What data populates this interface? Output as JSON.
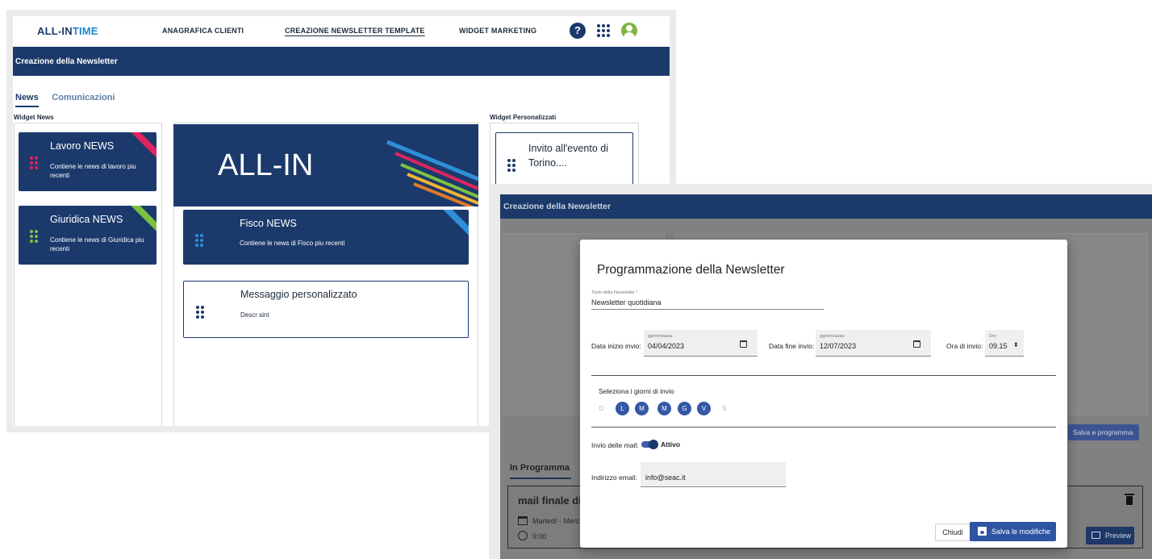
{
  "app": {
    "logo_text": "ALL-IN",
    "logo_accent": "TIME",
    "nav": [
      "ANAGRAFICA CLIENTI",
      "CREAZIONE NEWSLETTER TEMPLATE",
      "WIDGET MARKETING"
    ],
    "help_glyph": "?"
  },
  "screen1": {
    "title": "Creazione della Newsletter",
    "tabs": [
      "News",
      "Comunicazioni"
    ],
    "widget_news_label": "Widget News",
    "widget_pers_label": "Widget Personalizzati",
    "widgets_left": [
      {
        "title": "Lavoro NEWS",
        "desc": "Contiene le news di lavoro piu recenti",
        "accent": "#e0245e"
      },
      {
        "title": "Giuridica NEWS",
        "desc": "Contiene le news di Giuridica piu recenti",
        "accent": "#7cc242"
      }
    ],
    "banner_text": "ALL-IN",
    "center_widgets": [
      {
        "title": "Fisco NEWS",
        "desc": "Contiene le news di Fisco piu recenti",
        "accent": "#2f8fd8"
      },
      {
        "title": "Messaggio personalizzato",
        "desc": "Descr sint"
      }
    ],
    "custom_widget": {
      "title": "Invito all'evento di Torino...."
    }
  },
  "screen2": {
    "title": "Creazione della Newsletter",
    "salva_programma": "Salva e programma",
    "in_programma": "In Programma",
    "mail_card": {
      "title": "mail finale di",
      "days": "Martedì - Merc",
      "time": "9:00",
      "preview": "Preview"
    }
  },
  "modal": {
    "title": "Programmazione della Newsletter",
    "titolo_label": "Titolo della Newsletter *",
    "titolo_value": "Newsletter quotidiana",
    "data_inizio_label": "Data inizio invio:",
    "data_inizio_hint": "gg/mm/aaaa",
    "data_inizio_value": "04/04/2023",
    "data_fine_label": "Data fine invio:",
    "data_fine_hint": "gg/mm/aaaa",
    "data_fine_value": "12/07/2023",
    "ora_label": "Ora di invio:",
    "ora_hint": "Ore",
    "ora_value": "09.15",
    "giorni_label": "Seleziona i giorni di invio",
    "days": [
      {
        "label": "D",
        "selected": false
      },
      {
        "label": "L",
        "selected": true
      },
      {
        "label": "M",
        "selected": true
      },
      {
        "label": "M",
        "selected": true
      },
      {
        "label": "G",
        "selected": true
      },
      {
        "label": "V",
        "selected": true
      },
      {
        "label": "S",
        "selected": false
      }
    ],
    "invio_mail_label": "Invio delle mail:",
    "invio_mail_state": "Attivo",
    "email_label": "Indirizzo email:",
    "email_value": "info@seac.it",
    "chiudi": "Chiudi",
    "salva": "Salva le modifiche"
  },
  "colors": {
    "primary": "#1b3a6b",
    "button": "#2f54a3"
  }
}
